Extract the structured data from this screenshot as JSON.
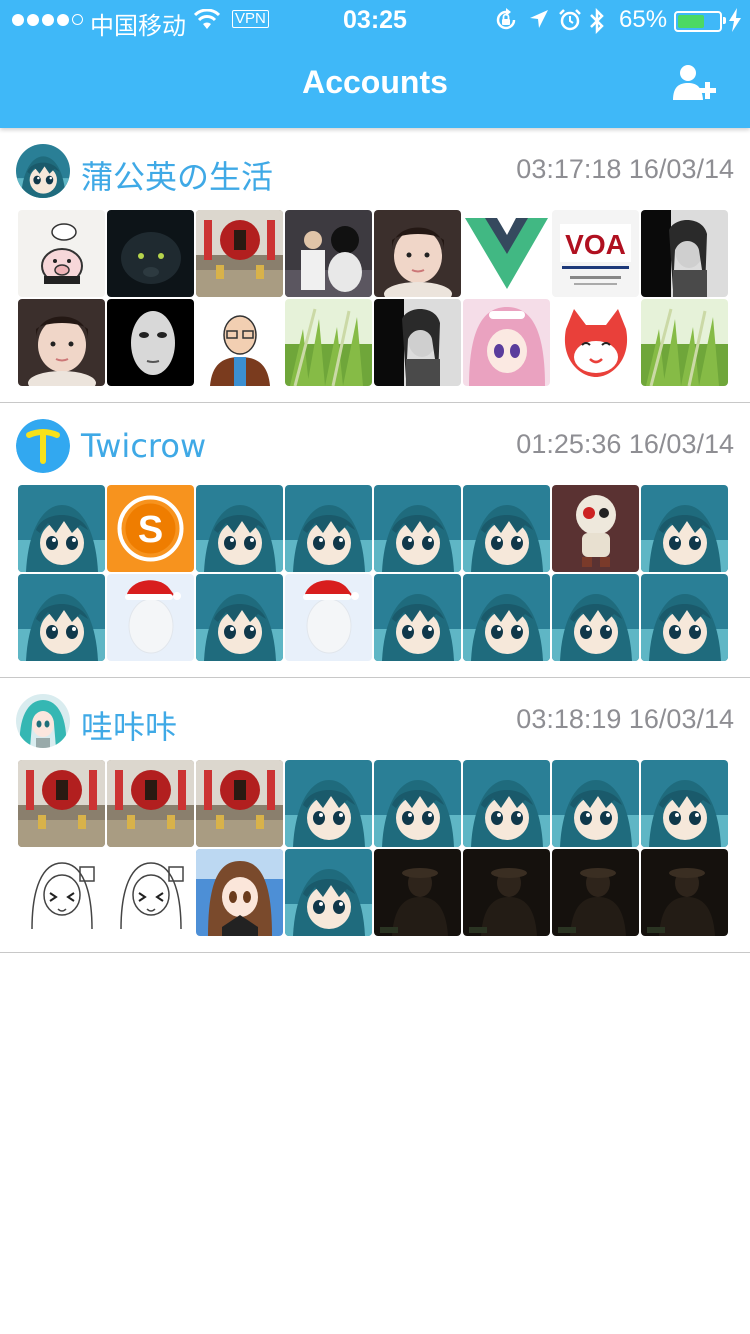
{
  "status_bar": {
    "carrier": "中国移动",
    "vpn": "VPN",
    "time": "03:25",
    "battery": "65%",
    "battery_level": 0.65,
    "icons": [
      "signal-dots-icon",
      "wifi-icon",
      "orientation-lock-icon",
      "location-icon",
      "alarm-icon",
      "bluetooth-icon",
      "battery-icon",
      "charging-icon"
    ]
  },
  "nav": {
    "title": "Accounts",
    "add_icon": "add-user-icon"
  },
  "colors": {
    "accent": "#3fb8f8",
    "name_text": "#3fa9e6",
    "time_text": "#8e8e93",
    "separator": "#c8c8c8"
  },
  "accounts": [
    {
      "name": "蒲公英の生活",
      "time": "03:17:18 16/03/14",
      "avatar": "anime-teal",
      "tiles": [
        "pig",
        "panther",
        "shrine",
        "photo-people",
        "girl-face",
        "vue-logo",
        "voa-logo",
        "bw-portrait",
        "girl-face",
        "mask",
        "cartoon-man",
        "grass",
        "bw-portrait",
        "anime-pink",
        "fox",
        "grass"
      ]
    },
    {
      "name": "Twicrow",
      "time": "01:25:36 16/03/14",
      "avatar": "t-logo",
      "tiles": [
        "anime-teal",
        "s-logo",
        "anime-teal",
        "anime-teal",
        "anime-teal",
        "anime-teal",
        "toy",
        "anime-teal",
        "anime-teal",
        "egg-hat",
        "anime-teal",
        "egg-hat",
        "anime-teal",
        "anime-teal",
        "anime-teal",
        "anime-teal"
      ]
    },
    {
      "name": "哇咔咔",
      "time": "03:18:19 16/03/14",
      "avatar": "miku",
      "tiles": [
        "shrine",
        "shrine",
        "shrine",
        "anime-teal",
        "anime-teal",
        "anime-teal",
        "anime-teal",
        "anime-teal",
        "sketch",
        "sketch",
        "anime-brown",
        "anime-teal",
        "dark-photo",
        "dark-photo",
        "dark-photo",
        "dark-photo"
      ]
    }
  ]
}
